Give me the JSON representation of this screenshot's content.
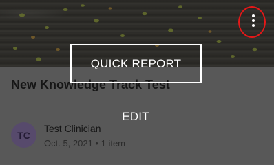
{
  "card": {
    "title": "New Knowledge Track Test",
    "author_initials": "TC",
    "author_name": "Test Clinician",
    "meta": "Oct. 5, 2021 • 1 item"
  },
  "context_menu": {
    "items": [
      {
        "label": "QUICK REPORT"
      },
      {
        "label": "EDIT"
      }
    ]
  },
  "icons": {
    "more": "more-vertical-icon"
  },
  "colors": {
    "overlay": "#5b5b5b",
    "highlight_ring": "#e41818",
    "menu_text": "#ffffff",
    "avatar_bg": "#574a6c"
  }
}
